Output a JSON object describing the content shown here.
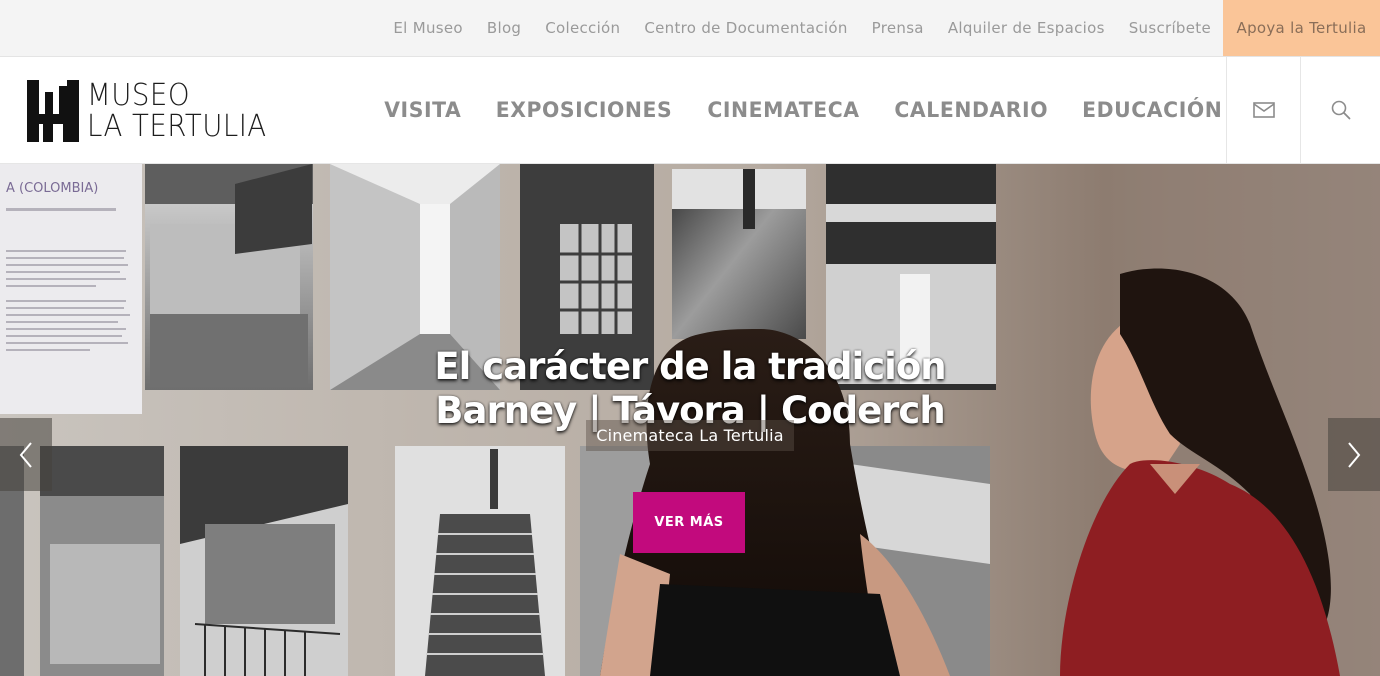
{
  "topbar": {
    "links": [
      {
        "label": "El Museo"
      },
      {
        "label": "Blog"
      },
      {
        "label": "Colección"
      },
      {
        "label": "Centro de Documentación"
      },
      {
        "label": "Prensa"
      },
      {
        "label": "Alquiler de Espacios"
      },
      {
        "label": "Suscríbete"
      }
    ],
    "support_label": "Apoya la Tertulia",
    "support_color": "#fac598"
  },
  "header": {
    "logo": {
      "line1": "MUSEO",
      "line2": "LA TERTULIA"
    },
    "nav": [
      {
        "label": "VISITA"
      },
      {
        "label": "EXPOSICIONES"
      },
      {
        "label": "CINEMATECA"
      },
      {
        "label": "CALENDARIO"
      },
      {
        "label": "EDUCACIÓN"
      }
    ],
    "icons": [
      "mail-icon",
      "search-icon"
    ]
  },
  "hero": {
    "title_line1": "El carácter de la tradición",
    "title_line2": "Barney | Távora | Coderch",
    "subtitle": "Cinemateca La Tertulia",
    "cta_label": "VER MÁS",
    "cta_color": "#c20a7d",
    "poster_text": "A (COLOMBIA)"
  }
}
